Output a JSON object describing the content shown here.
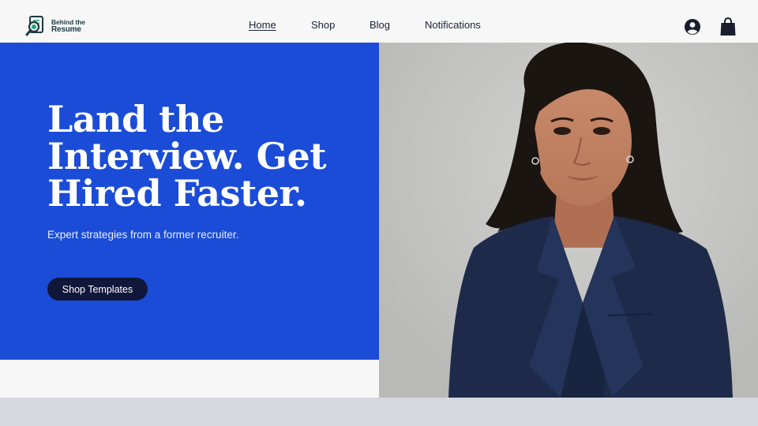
{
  "brand": {
    "line1": "Behind the",
    "line2": "Resume"
  },
  "nav": {
    "home": "Home",
    "shop": "Shop",
    "blog": "Blog",
    "notifications": "Notifications"
  },
  "hero": {
    "title": "Land the Interview. Get Hired Faster.",
    "subtitle": "Expert strategies from a former recruiter.",
    "cta_label": "Shop Templates"
  },
  "icons": {
    "account": "account-icon",
    "bag": "shopping-bag-icon",
    "logo": "resume-magnifier-icon"
  },
  "colors": {
    "hero_blue": "#1b4cd8",
    "cta_navy": "#11173a",
    "header_bg": "#f7f7f7"
  }
}
